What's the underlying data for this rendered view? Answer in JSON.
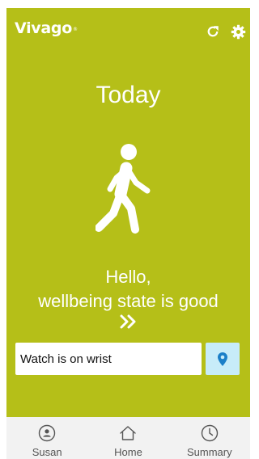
{
  "header": {
    "logo_text": "Vivago",
    "logo_mark": "®",
    "refresh_icon": "refresh-icon",
    "settings_icon": "gear-icon"
  },
  "main": {
    "title": "Today",
    "figure_icon": "walking-person-icon",
    "greeting_line1": "Hello,",
    "greeting_line2": "wellbeing state is good",
    "more_icon": "double-chevron-right-icon",
    "status_text": "Watch is on wrist",
    "location_icon": "location-pin-icon"
  },
  "nav": {
    "items": [
      {
        "label": "Susan",
        "icon": "user-circle-icon"
      },
      {
        "label": "Home",
        "icon": "home-icon"
      },
      {
        "label": "Summary",
        "icon": "clock-icon"
      }
    ]
  },
  "colors": {
    "background": "#b5bf18",
    "text_on_background": "#ffffff",
    "location_button": "#c7ecf9",
    "location_pin": "#1a7fc8",
    "nav_background": "#f2f2f2",
    "nav_text": "#555555"
  }
}
